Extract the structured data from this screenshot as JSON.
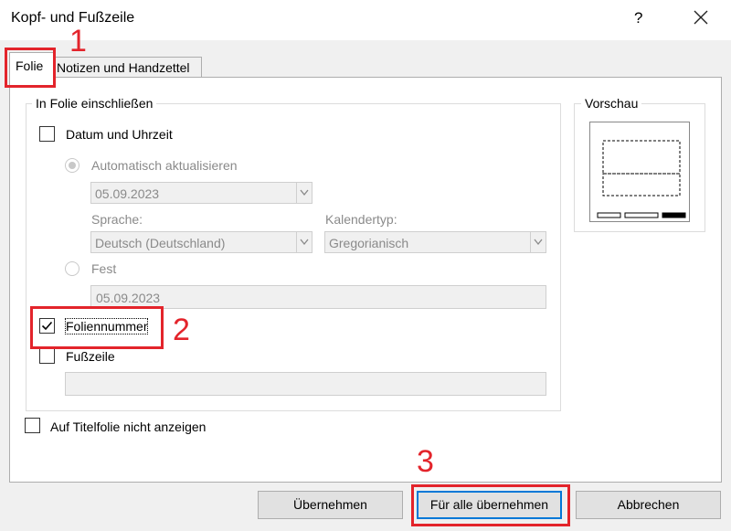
{
  "window": {
    "title": "Kopf- und Fußzeile",
    "help_symbol": "?"
  },
  "tabs": [
    {
      "label": "Folie",
      "selected": true
    },
    {
      "label": "Notizen und Handzettel",
      "selected": false
    }
  ],
  "include_group": {
    "legend": "In Folie einschließen",
    "date_time": {
      "label": "Datum und Uhrzeit",
      "checked": false
    },
    "auto_update": {
      "label": "Automatisch aktualisieren",
      "selected": true,
      "enabled": false
    },
    "date_format": {
      "value": "05.09.2023"
    },
    "language": {
      "label": "Sprache:",
      "value": "Deutsch (Deutschland)"
    },
    "calendar": {
      "label": "Kalendertyp:",
      "value": "Gregorianisch"
    },
    "fixed": {
      "label": "Fest",
      "selected": false,
      "enabled": false
    },
    "fixed_value": "05.09.2023",
    "slide_number": {
      "label": "Foliennummer",
      "checked": true
    },
    "footer": {
      "label": "Fußzeile",
      "checked": false,
      "value": ""
    }
  },
  "title_slide": {
    "label": "Auf Titelfolie nicht anzeigen",
    "checked": false
  },
  "preview": {
    "legend": "Vorschau"
  },
  "buttons": {
    "apply": "Übernehmen",
    "apply_all": "Für alle übernehmen",
    "cancel": "Abbrechen"
  },
  "annotations": [
    "1",
    "2",
    "3"
  ],
  "colors": {
    "annotation": "#e3242b",
    "accent": "#0078d7"
  }
}
